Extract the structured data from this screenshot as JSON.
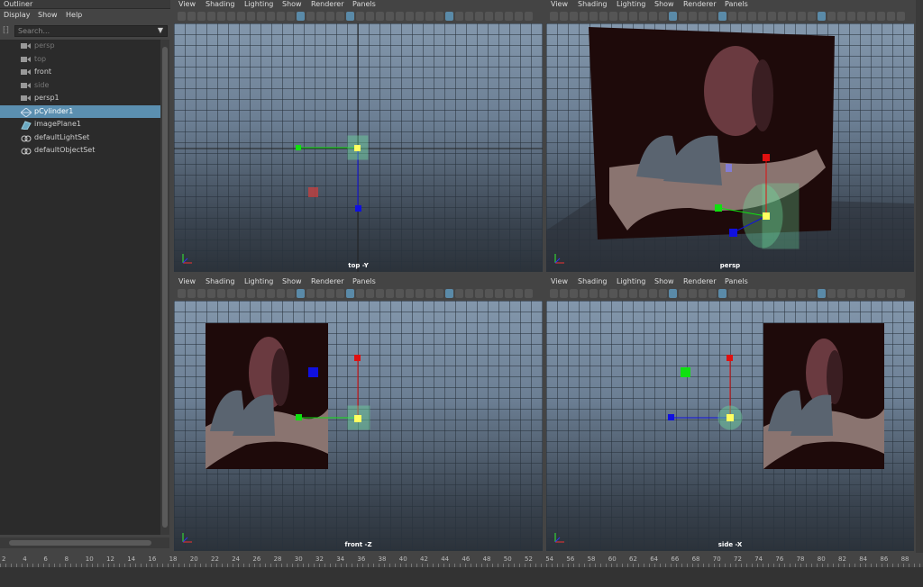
{
  "outliner": {
    "title": "Outliner",
    "menu": [
      "Display",
      "Show",
      "Help"
    ],
    "search_placeholder": "Search...",
    "items": [
      {
        "label": "persp",
        "icon": "camera-icon",
        "dim": true,
        "selected": false
      },
      {
        "label": "top",
        "icon": "camera-icon",
        "dim": true,
        "selected": false
      },
      {
        "label": "front",
        "icon": "camera-icon",
        "dim": false,
        "selected": false
      },
      {
        "label": "side",
        "icon": "camera-icon",
        "dim": true,
        "selected": false
      },
      {
        "label": "persp1",
        "icon": "camera-icon",
        "dim": false,
        "selected": false
      },
      {
        "label": "pCylinder1",
        "icon": "mesh-icon",
        "dim": false,
        "selected": true
      },
      {
        "label": "imagePlane1",
        "icon": "image-plane-icon",
        "dim": false,
        "selected": false
      },
      {
        "label": "defaultLightSet",
        "icon": "set-icon",
        "dim": false,
        "selected": false
      },
      {
        "label": "defaultObjectSet",
        "icon": "set-icon",
        "dim": false,
        "selected": false
      }
    ]
  },
  "viewport_menu": [
    "View",
    "Shading",
    "Lighting",
    "Show",
    "Renderer",
    "Panels"
  ],
  "viewports": {
    "top_left": {
      "label": "top -Y"
    },
    "top_right": {
      "label": "persp"
    },
    "bottom_left": {
      "label": "front -Z"
    },
    "bottom_right": {
      "label": "side -X"
    }
  },
  "timeline": {
    "ticks": [
      "2",
      "4",
      "6",
      "8",
      "10",
      "12",
      "14",
      "16",
      "18",
      "20",
      "22",
      "24",
      "26",
      "28",
      "30",
      "32",
      "34",
      "36",
      "38",
      "40",
      "42",
      "44",
      "46",
      "48",
      "50",
      "52",
      "54",
      "56",
      "58",
      "60",
      "62",
      "64",
      "66",
      "68",
      "70",
      "72",
      "74",
      "76",
      "78",
      "80",
      "82",
      "84",
      "86",
      "88"
    ]
  },
  "colors": {
    "selection": "#5b8fb0",
    "manip_x": "#e01010",
    "manip_y": "#10e010",
    "manip_z": "#1010e0",
    "mesh_wire": "#6fe0a0"
  }
}
